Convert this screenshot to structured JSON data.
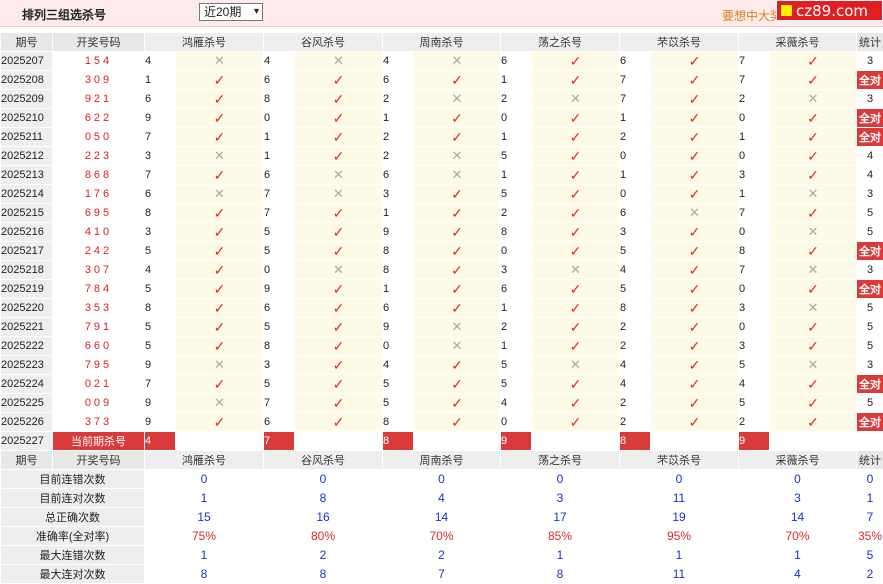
{
  "header": {
    "title": "排列三组选杀号",
    "select_value": "近20期",
    "promo": "要想中大奖",
    "logo_text": "cz89.com"
  },
  "columns": {
    "period": "期号",
    "numbers": "开奖号码",
    "experts": [
      "鸿雁杀号",
      "谷风杀号",
      "周南杀号",
      "荡之杀号",
      "芣苡杀号",
      "采薇杀号"
    ],
    "stat": "统计"
  },
  "rows": [
    {
      "p": "2025207",
      "n": "154",
      "k": [
        4,
        4,
        4,
        6,
        6,
        7
      ],
      "r": [
        0,
        0,
        0,
        1,
        1,
        1
      ],
      "s": "3"
    },
    {
      "p": "2025208",
      "n": "309",
      "k": [
        1,
        6,
        6,
        1,
        7,
        7
      ],
      "r": [
        1,
        1,
        1,
        1,
        1,
        1
      ],
      "s": "全对"
    },
    {
      "p": "2025209",
      "n": "921",
      "k": [
        6,
        8,
        2,
        2,
        7,
        2
      ],
      "r": [
        1,
        1,
        0,
        0,
        1,
        0
      ],
      "s": "3"
    },
    {
      "p": "2025210",
      "n": "622",
      "k": [
        9,
        0,
        1,
        0,
        1,
        0
      ],
      "r": [
        1,
        1,
        1,
        1,
        1,
        1
      ],
      "s": "全对"
    },
    {
      "p": "2025211",
      "n": "050",
      "k": [
        7,
        1,
        2,
        1,
        2,
        1
      ],
      "r": [
        1,
        1,
        1,
        1,
        1,
        1
      ],
      "s": "全对"
    },
    {
      "p": "2025212",
      "n": "223",
      "k": [
        3,
        1,
        2,
        5,
        0,
        0
      ],
      "r": [
        0,
        1,
        0,
        1,
        1,
        1
      ],
      "s": "4"
    },
    {
      "p": "2025213",
      "n": "868",
      "k": [
        7,
        6,
        6,
        1,
        1,
        3
      ],
      "r": [
        1,
        0,
        0,
        1,
        1,
        1
      ],
      "s": "4"
    },
    {
      "p": "2025214",
      "n": "176",
      "k": [
        6,
        7,
        3,
        5,
        0,
        1
      ],
      "r": [
        0,
        0,
        1,
        1,
        1,
        0
      ],
      "s": "3"
    },
    {
      "p": "2025215",
      "n": "695",
      "k": [
        8,
        7,
        1,
        2,
        6,
        7
      ],
      "r": [
        1,
        1,
        1,
        1,
        0,
        1
      ],
      "s": "5"
    },
    {
      "p": "2025216",
      "n": "410",
      "k": [
        3,
        5,
        9,
        8,
        3,
        0
      ],
      "r": [
        1,
        1,
        1,
        1,
        1,
        0
      ],
      "s": "5"
    },
    {
      "p": "2025217",
      "n": "242",
      "k": [
        5,
        5,
        8,
        0,
        5,
        8
      ],
      "r": [
        1,
        1,
        1,
        1,
        1,
        1
      ],
      "s": "全对"
    },
    {
      "p": "2025218",
      "n": "307",
      "k": [
        4,
        0,
        8,
        3,
        4,
        7
      ],
      "r": [
        1,
        0,
        1,
        0,
        1,
        0
      ],
      "s": "3"
    },
    {
      "p": "2025219",
      "n": "784",
      "k": [
        5,
        9,
        1,
        6,
        5,
        0
      ],
      "r": [
        1,
        1,
        1,
        1,
        1,
        1
      ],
      "s": "全对"
    },
    {
      "p": "2025220",
      "n": "353",
      "k": [
        8,
        6,
        6,
        1,
        8,
        3
      ],
      "r": [
        1,
        1,
        1,
        1,
        1,
        0
      ],
      "s": "5"
    },
    {
      "p": "2025221",
      "n": "791",
      "k": [
        5,
        5,
        9,
        2,
        2,
        0
      ],
      "r": [
        1,
        1,
        0,
        1,
        1,
        1
      ],
      "s": "5"
    },
    {
      "p": "2025222",
      "n": "660",
      "k": [
        5,
        8,
        0,
        1,
        2,
        3
      ],
      "r": [
        1,
        1,
        0,
        1,
        1,
        1
      ],
      "s": "5"
    },
    {
      "p": "2025223",
      "n": "795",
      "k": [
        9,
        3,
        4,
        5,
        4,
        5
      ],
      "r": [
        0,
        1,
        1,
        0,
        1,
        0
      ],
      "s": "3"
    },
    {
      "p": "2025224",
      "n": "021",
      "k": [
        7,
        5,
        5,
        5,
        4,
        4
      ],
      "r": [
        1,
        1,
        1,
        1,
        1,
        1
      ],
      "s": "全对"
    },
    {
      "p": "2025225",
      "n": "009",
      "k": [
        9,
        7,
        5,
        4,
        2,
        5
      ],
      "r": [
        0,
        1,
        1,
        1,
        1,
        1
      ],
      "s": "5"
    },
    {
      "p": "2025226",
      "n": "373",
      "k": [
        9,
        6,
        8,
        0,
        2,
        2
      ],
      "r": [
        1,
        1,
        1,
        1,
        1,
        1
      ],
      "s": "全对"
    }
  ],
  "current": {
    "period": "2025227",
    "label": "当前期杀号",
    "kills": [
      "4",
      "7",
      "8",
      "9",
      "8",
      "9"
    ]
  },
  "stats_header": {
    "period": "期号",
    "numbers": "开奖号码",
    "stat": "统计"
  },
  "stats": [
    {
      "label": "目前连错次数",
      "v": [
        "0",
        "0",
        "0",
        "0",
        "0",
        "0"
      ],
      "s": "0"
    },
    {
      "label": "目前连对次数",
      "v": [
        "1",
        "8",
        "4",
        "3",
        "11",
        "3"
      ],
      "s": "1"
    },
    {
      "label": "总正确次数",
      "v": [
        "15",
        "16",
        "14",
        "17",
        "19",
        "14"
      ],
      "s": "7"
    },
    {
      "label": "准确率(全对率)",
      "v": [
        "75%",
        "80%",
        "70%",
        "85%",
        "95%",
        "70%"
      ],
      "s": "35%",
      "red": true
    },
    {
      "label": "最大连错次数",
      "v": [
        "1",
        "2",
        "2",
        "1",
        "1",
        "1"
      ],
      "s": "5"
    },
    {
      "label": "最大连对次数",
      "v": [
        "8",
        "8",
        "7",
        "8",
        "11",
        "4"
      ],
      "s": "2"
    }
  ],
  "icons": {
    "right": "check-mark-icon",
    "wrong": "cross-mark-icon"
  },
  "colors": {
    "accent_red": "#d93a3a",
    "check_red": "#e02b2b",
    "cross_gray": "#a8a8a8",
    "stat_blue": "#1b33c9",
    "header_bg": "#fdeaea",
    "mark_bg": "#fdfbe8"
  }
}
